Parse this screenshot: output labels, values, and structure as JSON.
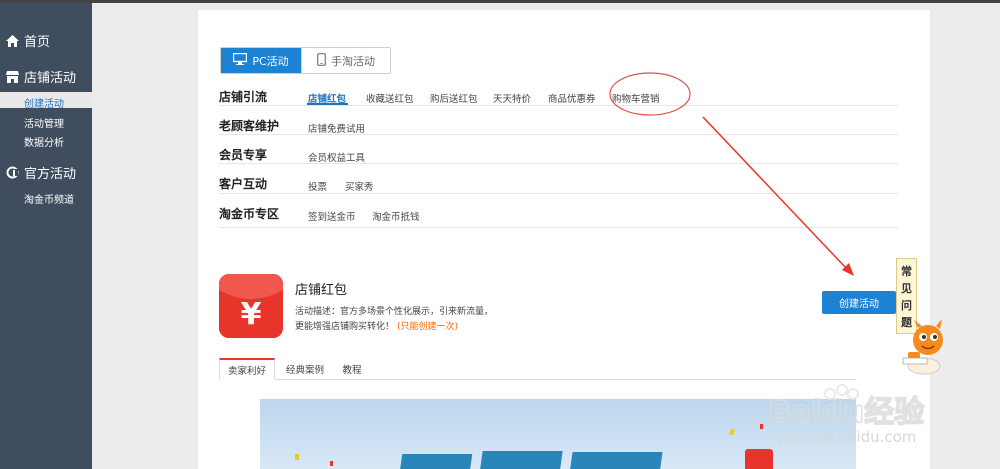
{
  "sidebar": {
    "home_label": "首页",
    "shop_activity_label": "店铺活动",
    "shop_sub_items": [
      {
        "label": "创建活动",
        "active": true
      },
      {
        "label": "活动管理",
        "active": false
      },
      {
        "label": "数据分析",
        "active": false
      }
    ],
    "official_activity_label": "官方活动",
    "official_sub_items": [
      {
        "label": "淘金币频道"
      }
    ]
  },
  "platform_toggle": {
    "pc_label": "PC活动",
    "mobile_label": "手淘活动",
    "selected": "pc"
  },
  "categories": [
    {
      "label": "店铺引流",
      "links": [
        "店铺红包",
        "收藏送红包",
        "购后送红包",
        "天天特价",
        "商品优惠券",
        "购物车营销"
      ]
    },
    {
      "label": "老顾客维护",
      "links": [
        "店铺免费试用"
      ]
    },
    {
      "label": "会员专享",
      "links": [
        "会员权益工具"
      ]
    },
    {
      "label": "客户互动",
      "links": [
        "投票",
        "买家秀"
      ]
    },
    {
      "label": "淘金币专区",
      "links": [
        "签到送金币",
        "淘金币抵钱"
      ]
    }
  ],
  "selected_link": "店铺红包",
  "featured": {
    "icon_symbol": "¥",
    "title": "店铺红包",
    "description_line1": "活动描述：官方多场景个性化展示，引来新流量，",
    "description_line2": "更能增强店铺购买转化！",
    "limit_note": "(只能创建一次)",
    "create_button": "创建活动"
  },
  "faq_label_chars": [
    "常",
    "见",
    "问",
    "题"
  ],
  "tabs": [
    {
      "label": "卖家利好",
      "active": true
    },
    {
      "label": "经典案例",
      "active": false
    },
    {
      "label": "教程",
      "active": false
    }
  ],
  "watermark": {
    "brand": "Baidu经验",
    "url": "jingyan.baidu.com"
  },
  "colors": {
    "sidebar_bg": "#3f4d5e",
    "accent_blue": "#1d82d2",
    "annotation_red": "#e8352c"
  }
}
